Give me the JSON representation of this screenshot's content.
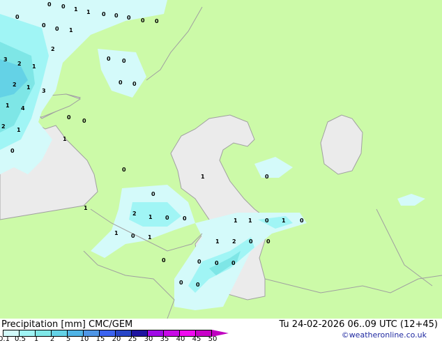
{
  "map": {
    "colors": {
      "land": "#ccfaa8",
      "water": "#ebebeb",
      "precip_light": "#d4fafa",
      "precip_1": "#a0f5f5",
      "precip_2": "#7ee6e6",
      "precip_3": "#64d2e6",
      "border": "#a0a0a0"
    },
    "labels": [
      "0",
      "0",
      "1",
      "1",
      "0",
      "0",
      "0",
      "0",
      "0",
      "0",
      "0",
      "0",
      "1",
      "2",
      "2",
      "1",
      "3",
      "2",
      "1",
      "3",
      "1",
      "4",
      "2",
      "1",
      "0",
      "0",
      "0",
      "0",
      "0",
      "0",
      "0",
      "1",
      "1",
      "2",
      "1",
      "0",
      "0",
      "0",
      "0",
      "1",
      "0",
      "1",
      "1",
      "0",
      "1",
      "0",
      "1",
      "2",
      "0",
      "0",
      "1",
      "0",
      "1",
      "0",
      "0",
      "0",
      "0",
      "0",
      "0"
    ]
  },
  "footer": {
    "title": "Precipitation [mm]  CMC/GEM",
    "datetime": "Tu 24-02-2026 06..09 UTC (12+45)",
    "credit": "©weatheronline.co.uk"
  },
  "colorbar": {
    "colors": [
      "#d2fafa",
      "#a0f5f5",
      "#80e8e8",
      "#64d2e6",
      "#50b4e6",
      "#4f96e6",
      "#3c64f0",
      "#2846c8",
      "#1e14a0",
      "#a00ae6",
      "#c80ae6",
      "#f00af0",
      "#c800c8"
    ],
    "ticks": [
      "0.1",
      "0.5",
      "1",
      "2",
      "5",
      "10",
      "15",
      "20",
      "25",
      "30",
      "35",
      "40",
      "45",
      "50"
    ]
  }
}
